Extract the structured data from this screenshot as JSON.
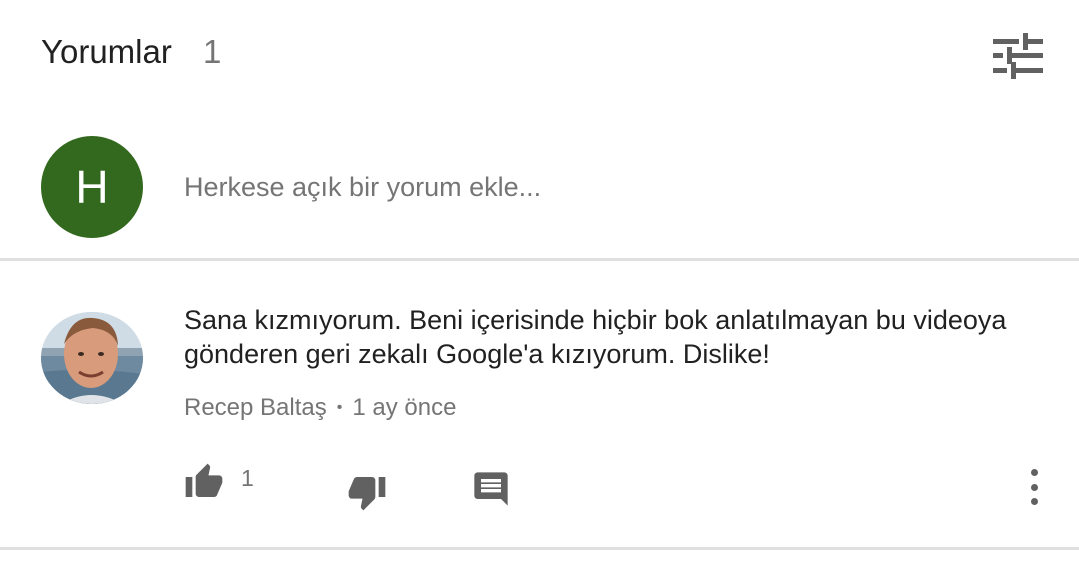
{
  "header": {
    "title": "Yorumlar",
    "count": "1",
    "sort_icon": "tune-icon"
  },
  "add_comment": {
    "avatar_letter": "H",
    "avatar_color": "#33691e",
    "placeholder": "Herkese açık bir yorum ekle..."
  },
  "comments": [
    {
      "text": "Sana kızmıyorum. Beni içerisinde hiçbir bok anlatılmayan bu videoya gönderen geri zekalı Google'a kızıyorum. Dislike!",
      "author": "Recep Baltaş",
      "separator": "•",
      "time": "1 ay önce",
      "like_count": "1",
      "icons": [
        "thumb-up-icon",
        "thumb-down-icon",
        "reply-icon",
        "more-vert-icon"
      ]
    }
  ],
  "colors": {
    "primary_text": "#212121",
    "secondary_text": "#757575",
    "icon": "#616161",
    "divider": "#e0e0e0"
  }
}
